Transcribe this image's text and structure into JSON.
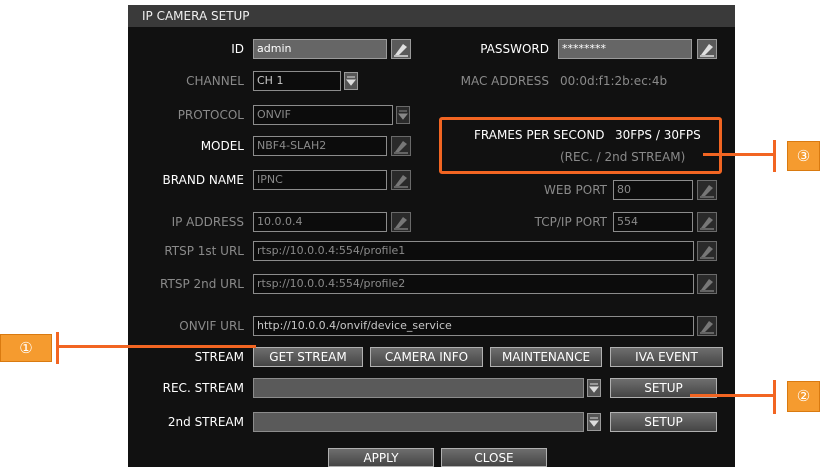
{
  "title": "IP CAMERA SETUP",
  "id": {
    "label": "ID",
    "value": "admin"
  },
  "password": {
    "label": "PASSWORD",
    "value": "********"
  },
  "channel": {
    "label": "CHANNEL",
    "value": "CH 1"
  },
  "mac": {
    "label": "MAC ADDRESS",
    "value": "00:0d:f1:2b:ec:4b"
  },
  "protocol": {
    "label": "PROTOCOL",
    "value": "ONVIF"
  },
  "model": {
    "label": "MODEL",
    "value": "NBF4-SLAH2"
  },
  "brand": {
    "label": "BRAND NAME",
    "value": "IPNC"
  },
  "fps": {
    "label": "FRAMES PER SECOND",
    "value": "30FPS / 30FPS",
    "sub": "(REC. / 2nd STREAM)"
  },
  "web_port": {
    "label": "WEB PORT",
    "value": "80"
  },
  "ip": {
    "label": "IP ADDRESS",
    "value": "10.0.0.4"
  },
  "tcp_port": {
    "label": "TCP/IP PORT",
    "value": "554"
  },
  "rtsp1": {
    "label": "RTSP 1st URL",
    "value": "rtsp://10.0.0.4:554/profile1"
  },
  "rtsp2": {
    "label": "RTSP 2nd URL",
    "value": "rtsp://10.0.0.4:554/profile2"
  },
  "onvif": {
    "label": "ONVIF URL",
    "value": "http://10.0.0.4/onvif/device_service"
  },
  "stream": {
    "label": "STREAM",
    "buttons": [
      "GET STREAM",
      "CAMERA INFO",
      "MAINTENANCE",
      "IVA EVENT"
    ]
  },
  "rec_stream": {
    "label": "REC. STREAM",
    "value": "",
    "button": "SETUP"
  },
  "second_stream": {
    "label": "2nd STREAM",
    "value": "",
    "button": "SETUP"
  },
  "footer": {
    "apply": "APPLY",
    "close": "CLOSE"
  },
  "callouts": [
    "①",
    "②",
    "③"
  ],
  "colors": {
    "highlight": "#f26522",
    "badge": "#f59b2f",
    "background": "#111111"
  }
}
